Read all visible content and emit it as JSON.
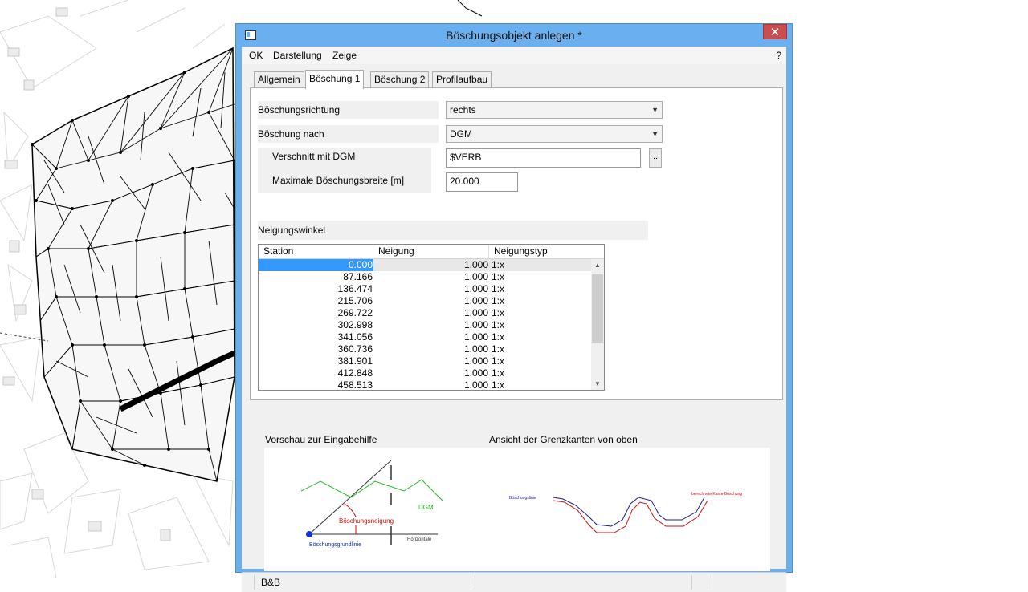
{
  "window": {
    "title": "Böschungsobjekt anlegen *",
    "close_symbol": "✕",
    "icon": "window-icon"
  },
  "menu": {
    "items": [
      "OK",
      "Darstellung",
      "Zeige"
    ],
    "help": "?"
  },
  "tabs": [
    {
      "label": "Allgemein",
      "active": false
    },
    {
      "label": "Böschung 1",
      "active": true
    },
    {
      "label": "Böschung 2",
      "active": false
    },
    {
      "label": "Profilaufbau",
      "active": false
    }
  ],
  "form": {
    "direction_label": "Böschungsrichtung",
    "direction_value": "rechts",
    "target_label": "Böschung nach",
    "target_value": "DGM",
    "intersect_label": "Verschnitt mit DGM",
    "intersect_value": "$VERB",
    "browse_label": "..",
    "max_width_label": "Maximale Böschungsbreite [m]",
    "max_width_value": "20.000"
  },
  "slope_section": {
    "title": "Neigungswinkel",
    "columns": [
      "Station",
      "Neigung",
      "Neigungstyp"
    ],
    "rows": [
      {
        "station": "0.000",
        "neigung": "1.000",
        "typ": "1:x",
        "selected": true
      },
      {
        "station": "87.166",
        "neigung": "1.000",
        "typ": "1:x"
      },
      {
        "station": "136.474",
        "neigung": "1.000",
        "typ": "1:x"
      },
      {
        "station": "215.706",
        "neigung": "1.000",
        "typ": "1:x"
      },
      {
        "station": "269.722",
        "neigung": "1.000",
        "typ": "1:x"
      },
      {
        "station": "302.998",
        "neigung": "1.000",
        "typ": "1:x"
      },
      {
        "station": "341.056",
        "neigung": "1.000",
        "typ": "1:x"
      },
      {
        "station": "360.736",
        "neigung": "1.000",
        "typ": "1:x"
      },
      {
        "station": "381.901",
        "neigung": "1.000",
        "typ": "1:x"
      },
      {
        "station": "412.848",
        "neigung": "1.000",
        "typ": "1:x"
      },
      {
        "station": "458.513",
        "neigung": "1.000",
        "typ": "1:x"
      }
    ]
  },
  "preview": {
    "left_title": "Vorschau zur Eingabehilfe",
    "right_title": "Ansicht der Grenzkanten von oben",
    "labels": {
      "dgm": "DGM",
      "slope": "Böschungsneigung",
      "horizontal": "Horizontale",
      "baseline": "Böschungsgrundlinie",
      "edge_left": "Böschungslinie",
      "edge_right": "berechnete Kante Böschung"
    },
    "colors": {
      "dgm": "#22bb22",
      "slope": "#cc1111",
      "baseline": "#1133aa",
      "edge_blue": "#1a1a8c",
      "edge_red": "#cc1111"
    }
  },
  "status": {
    "left": "B&B"
  }
}
